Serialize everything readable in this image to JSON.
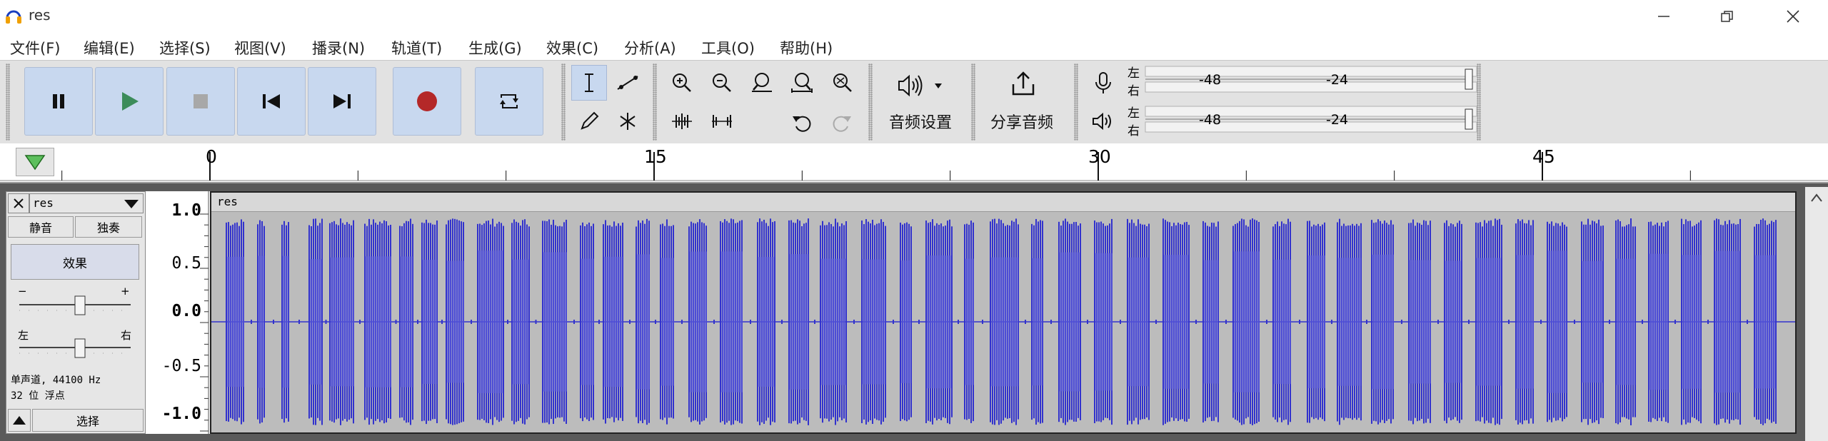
{
  "window": {
    "title": "res"
  },
  "menu": [
    "文件(F)",
    "编辑(E)",
    "选择(S)",
    "视图(V)",
    "播录(N)",
    "轨道(T)",
    "生成(G)",
    "效果(C)",
    "分析(A)",
    "工具(O)",
    "帮助(H)"
  ],
  "toolbar": {
    "audio_setup_label": "音频设置",
    "share_audio_label": "分享音频"
  },
  "meters": {
    "left_char": "左",
    "right_char": "右",
    "ticks": [
      "-48",
      "-24"
    ]
  },
  "timeline": {
    "ticks": [
      "0",
      "15",
      "30",
      "45"
    ]
  },
  "track": {
    "name": "res",
    "clip_name": "res",
    "mute_label": "静音",
    "solo_label": "独奏",
    "effects_label": "效果",
    "gain_minus": "−",
    "gain_plus": "+",
    "pan_left": "左",
    "pan_right": "右",
    "info_line1": "单声道, 44100 Hz",
    "info_line2": "32 位 浮点",
    "select_label": "选择",
    "scale": [
      "1.0",
      "0.5",
      "0.0",
      "-0.5",
      "-1.0"
    ]
  },
  "colors": {
    "waveform": "#3232cd",
    "waveform_rms": "#6464dc",
    "play_green": "#3c8c5a",
    "record_red": "#b42828"
  }
}
